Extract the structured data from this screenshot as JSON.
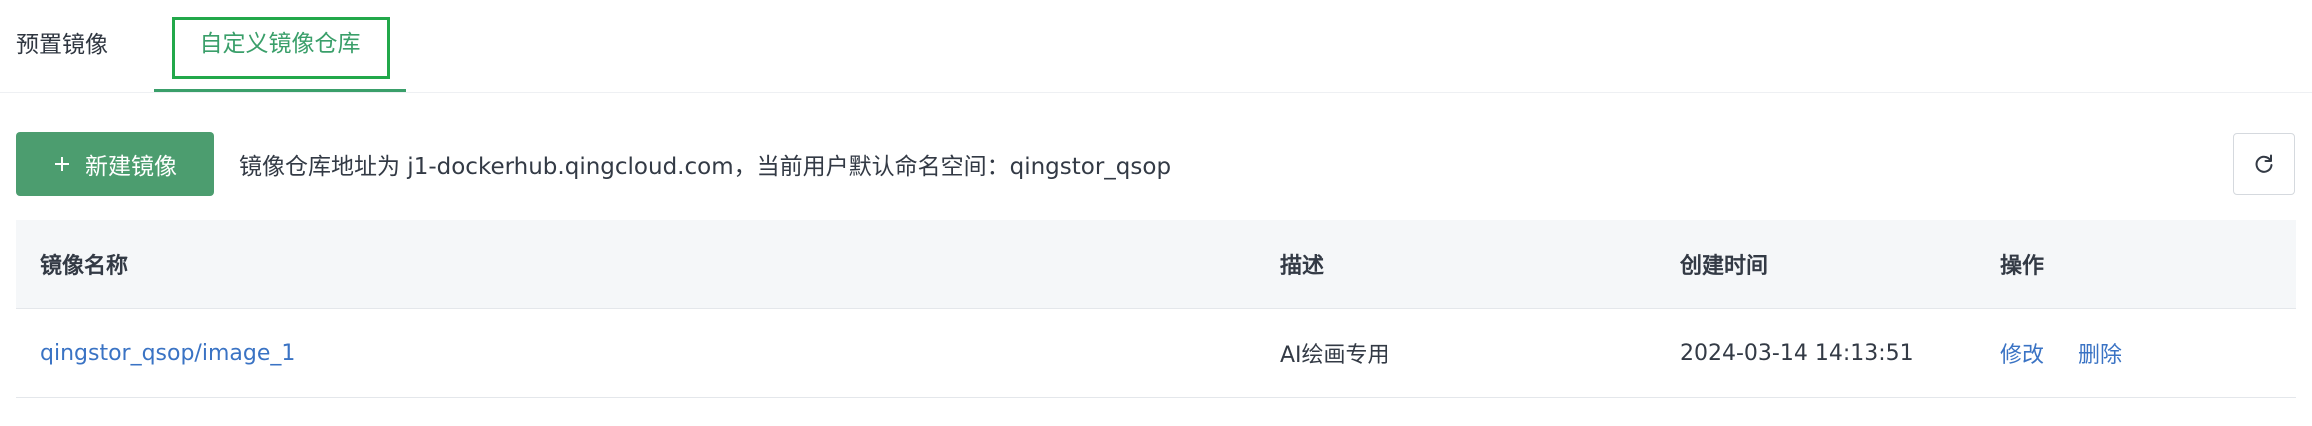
{
  "tabs": {
    "preset": "预置镜像",
    "custom": "自定义镜像仓库"
  },
  "toolbar": {
    "new_image_label": "新建镜像",
    "registry_info": "镜像仓库地址为 j1-dockerhub.qingcloud.com，当前用户默认命名空间：qingstor_qsop"
  },
  "table": {
    "columns": {
      "name": "镜像名称",
      "description": "描述",
      "created": "创建时间",
      "actions": "操作"
    },
    "rows": [
      {
        "name": "qingstor_qsop/image_1",
        "description": "AI绘画专用",
        "created": "2024-03-14 14:13:51",
        "edit": "修改",
        "delete": "删除"
      }
    ]
  },
  "colors": {
    "accent": "#4c9d6f",
    "link": "#3a73c4",
    "focus_outline": "#22a84a"
  },
  "icons": {
    "new_button": "plus-icon",
    "refresh_button": "refresh-icon"
  }
}
